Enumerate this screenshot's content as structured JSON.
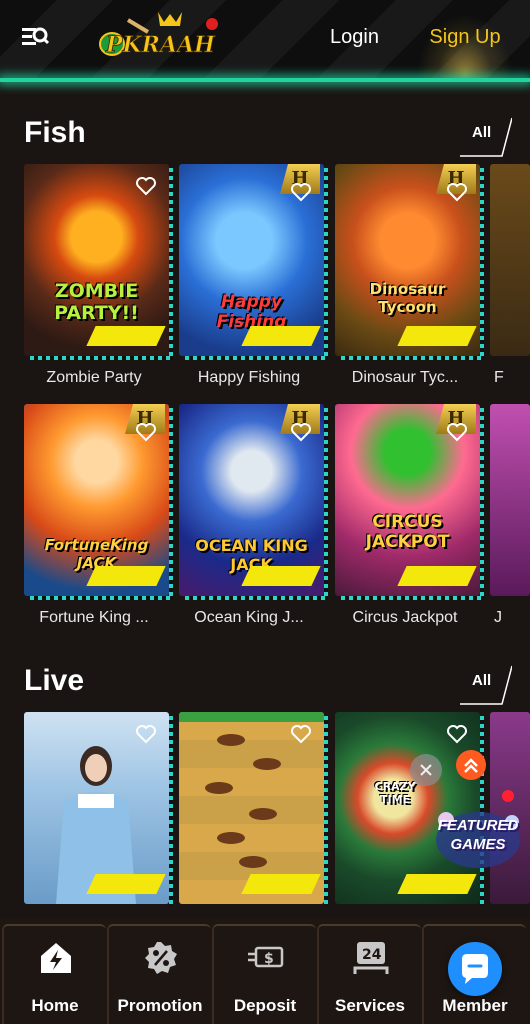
{
  "header": {
    "logo_text": "PKRAAH",
    "login_label": "Login",
    "signup_label": "Sign Up"
  },
  "sections": {
    "fish": {
      "title": "Fish",
      "all_label": "All",
      "games": [
        {
          "name": "Zombie Party",
          "art": "ZOMBIE PARTY!!"
        },
        {
          "name": "Happy Fishing",
          "art": "Happy Fishing"
        },
        {
          "name": "Dinosaur Tyc...",
          "art": "Dinosaur Tycoon"
        },
        {
          "name": "F",
          "art": ""
        },
        {
          "name": "Fortune King ...",
          "art": "FortuneKing JACK"
        },
        {
          "name": "Ocean King J...",
          "art": "OCEAN KING JACK"
        },
        {
          "name": "Circus Jackpot",
          "art": "CIRCUS JACKPOT"
        },
        {
          "name": "J",
          "art": ""
        }
      ]
    },
    "live": {
      "title": "Live",
      "all_label": "All",
      "games": [
        {
          "name": "",
          "art": ""
        },
        {
          "name": "",
          "art": ""
        },
        {
          "name": "",
          "art": "CRAZY TIME"
        },
        {
          "name": "",
          "art": ""
        }
      ]
    }
  },
  "floating": {
    "featured_label": "FEATURED GAMES"
  },
  "bottom_nav": {
    "items": [
      {
        "label": "Home",
        "icon": "home-bolt-icon"
      },
      {
        "label": "Promotion",
        "icon": "percent-badge-icon"
      },
      {
        "label": "Deposit",
        "icon": "cash-arrow-icon"
      },
      {
        "label": "Services",
        "icon": "24h-support-icon"
      },
      {
        "label": "Member",
        "icon": "member-icon"
      }
    ]
  },
  "colors": {
    "accent_gold": "#f5c518",
    "accent_teal": "#22d3a0",
    "tag_yellow": "#f4e70b",
    "chat_blue": "#1f8fff"
  }
}
